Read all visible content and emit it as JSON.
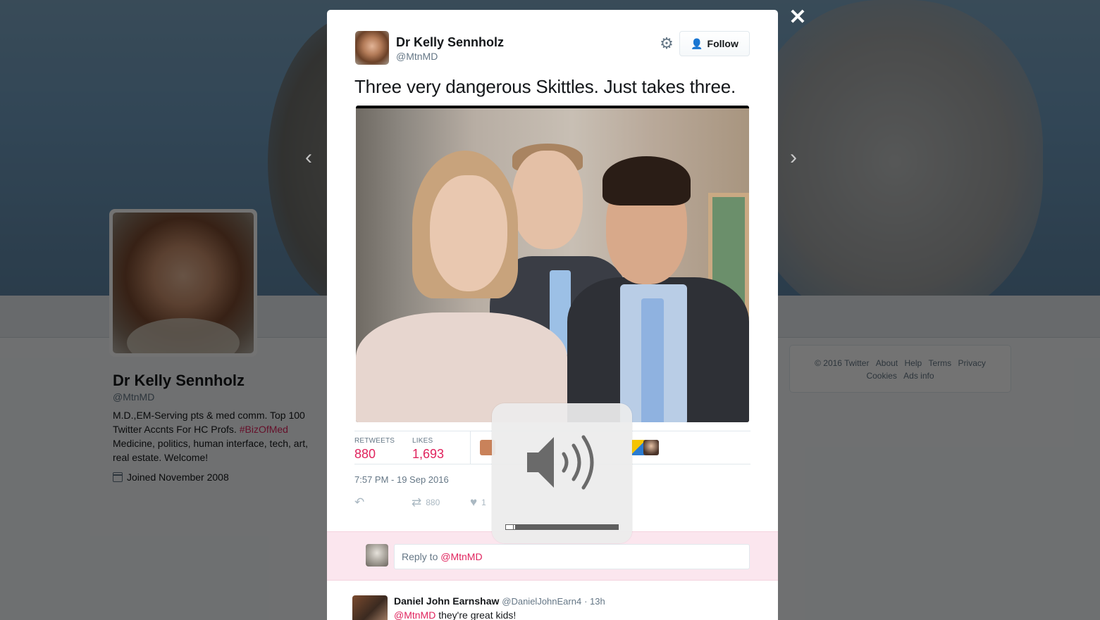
{
  "background_profile": {
    "name": "Dr Kelly Sennholz",
    "handle": "@MtnMD",
    "bio_line1": "M.D.,EM-Serving pts & med comm. Top 100",
    "bio_line2_prefix": "Twitter Accnts For HC Profs. ",
    "bio_hashtag": "#BizOfMed",
    "bio_line3": "Medicine, politics, human interface, tech, art,",
    "bio_line4": "real estate. Welcome!",
    "joined": "Joined November 2008"
  },
  "footer": {
    "copyright": "© 2016 Twitter",
    "links": [
      "About",
      "Help",
      "Terms",
      "Privacy",
      "Cookies",
      "Ads info"
    ]
  },
  "modal": {
    "author_name": "Dr Kelly Sennholz",
    "author_handle": "@MtnMD",
    "follow_label": "Follow",
    "tweet_text": "Three very dangerous Skittles. Just takes three.",
    "retweets_label": "RETWEETS",
    "retweets_value": "880",
    "likes_label": "LIKES",
    "likes_value": "1,693",
    "timestamp": "7:57 PM - 19 Sep 2016",
    "action_retweet_count": "880",
    "action_like_count": "1",
    "reply_placeholder_prefix": "Reply to ",
    "reply_placeholder_mention": "@MtnMD"
  },
  "reply_tweet": {
    "name": "Daniel John Earnshaw",
    "handle": "@DanielJohnEarn4",
    "age": "· 13h",
    "mention": "@MtnMD",
    "text": " they're great kids!"
  },
  "icons": {
    "close": "close-icon",
    "prev": "chevron-left-icon",
    "next": "chevron-right-icon",
    "gear": "gear-icon",
    "follow": "add-user-icon",
    "reply": "reply-icon",
    "retweet": "retweet-icon",
    "like": "heart-icon",
    "volume": "speaker-icon"
  },
  "volume_level": 0.08,
  "colors": {
    "accent": "#e0245e",
    "link_blue": "#1da1f2",
    "reply_bg": "#fbe6ee"
  }
}
